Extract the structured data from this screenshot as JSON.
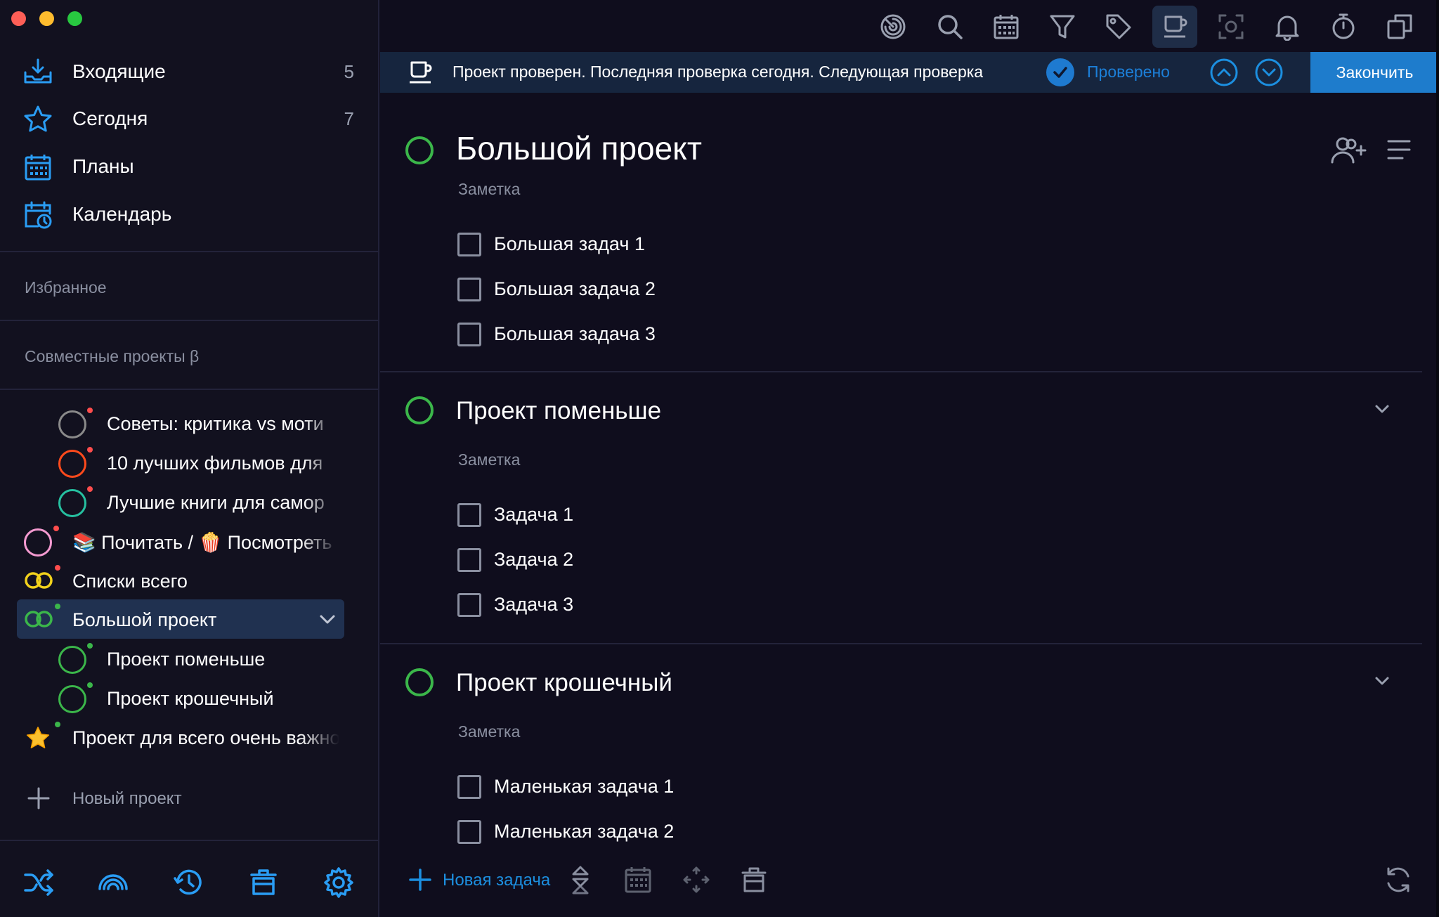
{
  "colors": {
    "accent": "#1c7fd8",
    "project_green": "#3bb64a",
    "sidebar_bg": "#12111f",
    "main_bg": "#0f0d1d",
    "banner_bg": "#16253e"
  },
  "sidebar": {
    "nav": [
      {
        "label": "Входящие",
        "count": "5",
        "icon": "inbox-icon"
      },
      {
        "label": "Сегодня",
        "count": "7",
        "icon": "star-icon"
      },
      {
        "label": "Планы",
        "count": "",
        "icon": "calendar-grid-icon"
      },
      {
        "label": "Календарь",
        "count": "",
        "icon": "calendar-clock-icon"
      }
    ],
    "favorites_label": "Избранное",
    "shared_label": "Совместные проекты β",
    "projects": [
      {
        "label": "Советы: критика vs моти",
        "icon": "gray-ring-icon"
      },
      {
        "label": "10 лучших фильмов для",
        "icon": "red-ring-icon"
      },
      {
        "label": "Лучшие книги для самор",
        "icon": "teal-ring-icon"
      },
      {
        "label": "📚 Почитать / 🍿 Посмотреть",
        "icon": "pink-ring-icon"
      },
      {
        "label": "Списки всего",
        "icon": "yellow-double-ring-icon"
      },
      {
        "label": "Большой проект",
        "icon": "green-double-ring-icon"
      },
      {
        "label": "Проект поменьше",
        "icon": "green-ring-icon"
      },
      {
        "label": "Проект крошечный",
        "icon": "green-ring-icon"
      },
      {
        "label": "Проект для всего очень важного",
        "icon": "star-emoji-icon"
      }
    ],
    "new_project_label": "Новый проект"
  },
  "banner": {
    "text": "Проект проверен. Последняя проверка сегодня. Следующая проверка",
    "verified_label": "Проверено",
    "finish_label": "Закончить"
  },
  "main": {
    "projects": [
      {
        "title": "Большой проект",
        "note": "Заметка",
        "tasks": [
          "Большая задач 1",
          "Большая задача 2",
          "Большая задача 3"
        ]
      },
      {
        "title": "Проект поменьше",
        "note": "Заметка",
        "tasks": [
          "Задача 1",
          "Задача 2",
          "Задача 3"
        ]
      },
      {
        "title": "Проект крошечный",
        "note": "Заметка",
        "tasks": [
          "Маленькая задача 1",
          "Маленькая задача 2"
        ]
      }
    ],
    "new_task_label": "Новая задача"
  }
}
